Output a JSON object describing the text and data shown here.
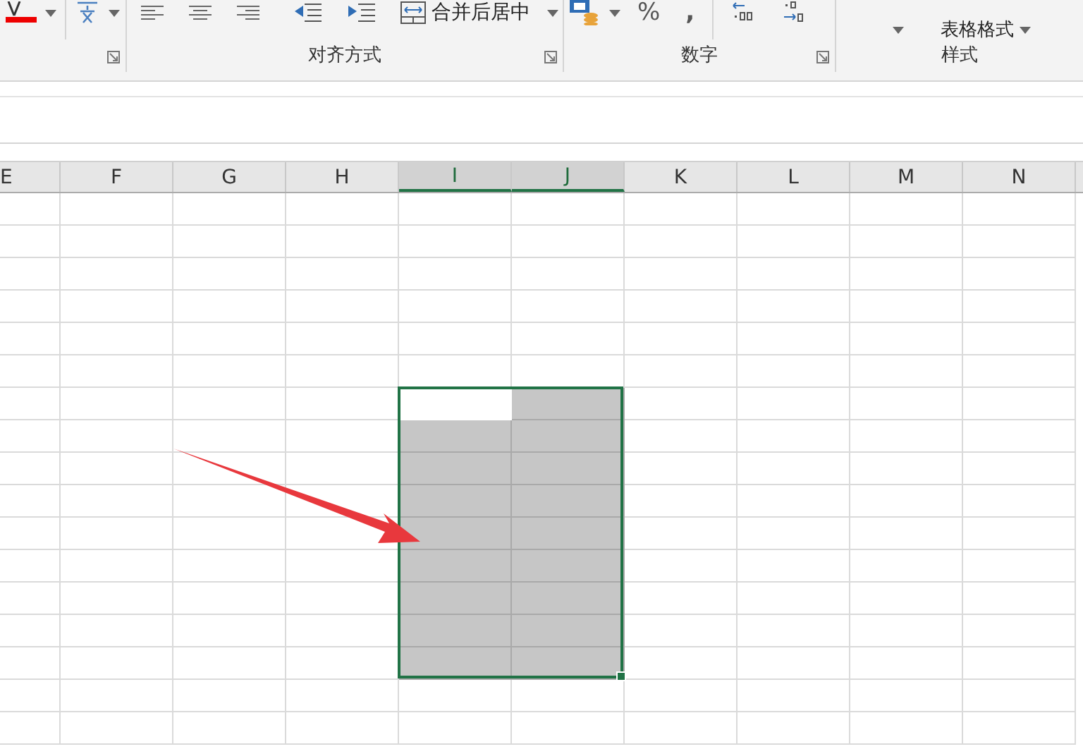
{
  "ribbon": {
    "groups": [
      {
        "kind": "font"
      },
      {
        "kind": "alignment",
        "label": "对齐方式",
        "merge_button": "合并后居中"
      },
      {
        "kind": "number",
        "label": "数字",
        "percent": "%",
        "comma": ","
      },
      {
        "kind": "styles",
        "label": "样式",
        "table_format": "表格格式"
      }
    ]
  },
  "columns": [
    {
      "label": "E",
      "selected": false
    },
    {
      "label": "F",
      "selected": false
    },
    {
      "label": "G",
      "selected": false
    },
    {
      "label": "H",
      "selected": false
    },
    {
      "label": "I",
      "selected": true
    },
    {
      "label": "J",
      "selected": true
    },
    {
      "label": "K",
      "selected": false
    },
    {
      "label": "L",
      "selected": false
    },
    {
      "label": "M",
      "selected": false
    },
    {
      "label": "N",
      "selected": false
    }
  ],
  "rows": [
    {
      "selected": false,
      "active": false
    },
    {
      "selected": false,
      "active": false
    },
    {
      "selected": false,
      "active": false
    },
    {
      "selected": false,
      "active": false
    },
    {
      "selected": false,
      "active": false
    },
    {
      "selected": false,
      "active": false
    },
    {
      "selected": true,
      "active": true
    },
    {
      "selected": true,
      "active": false
    },
    {
      "selected": true,
      "active": false
    },
    {
      "selected": true,
      "active": false
    },
    {
      "selected": true,
      "active": false
    },
    {
      "selected": true,
      "active": false
    },
    {
      "selected": true,
      "active": false
    },
    {
      "selected": true,
      "active": false
    },
    {
      "selected": true,
      "active": false
    },
    {
      "selected": false,
      "active": false
    },
    {
      "selected": false,
      "active": false
    }
  ]
}
